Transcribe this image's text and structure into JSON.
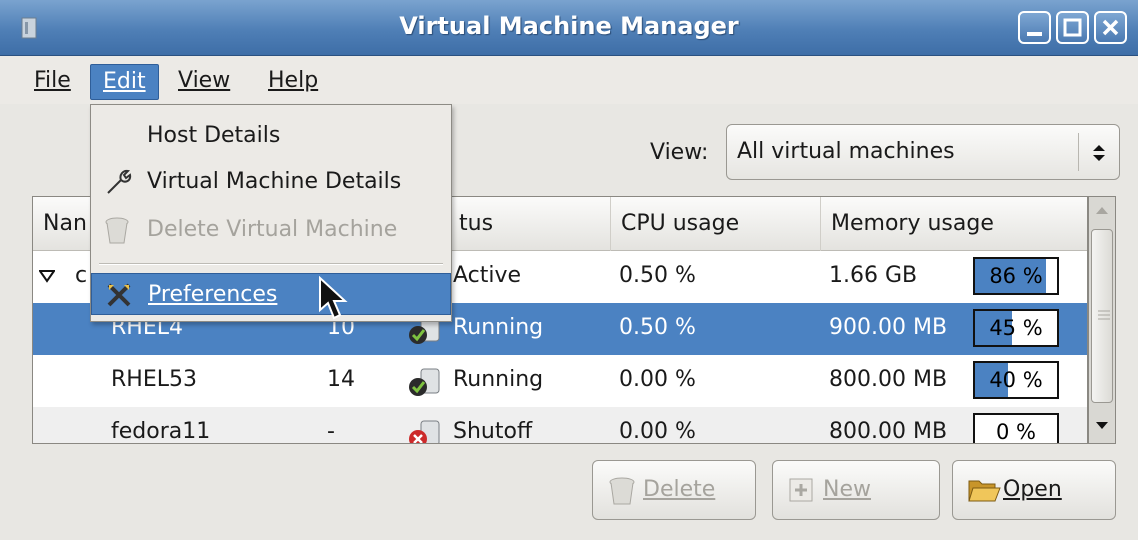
{
  "window": {
    "title": "Virtual Machine Manager"
  },
  "menubar": {
    "items": [
      {
        "label": "File"
      },
      {
        "label": "Edit"
      },
      {
        "label": "View"
      },
      {
        "label": "Help"
      }
    ]
  },
  "view_selector": {
    "label": "View:",
    "value": "All virtual machines"
  },
  "table": {
    "columns": [
      "Nan",
      "tus",
      "CPU usage",
      "Memory usage"
    ],
    "rows": [
      {
        "name": "c",
        "id": "",
        "status": "Active",
        "cpu": "0.50 %",
        "memory": "1.66 GB",
        "mem_pct_label": "86 %",
        "mem_fraction": 0.86
      },
      {
        "name": "RHEL4",
        "id": "10",
        "status": "Running",
        "cpu": "0.50 %",
        "memory": "900.00 MB",
        "mem_pct_label": "45 %",
        "mem_fraction": 0.45
      },
      {
        "name": "RHEL53",
        "id": "14",
        "status": "Running",
        "cpu": "0.00 %",
        "memory": "800.00 MB",
        "mem_pct_label": "40 %",
        "mem_fraction": 0.4
      },
      {
        "name": "fedora11",
        "id": "-",
        "status": "Shutoff",
        "cpu": "0.00 %",
        "memory": "800.00 MB",
        "mem_pct_label": "0 %",
        "mem_fraction": 0.0
      }
    ]
  },
  "buttons": {
    "delete": "Delete",
    "new": "New",
    "open": "Open"
  },
  "edit_menu": {
    "items": [
      {
        "label": "Host Details"
      },
      {
        "label": "Virtual Machine Details"
      },
      {
        "label": "Delete Virtual Machine"
      },
      {
        "label": "Preferences"
      }
    ]
  },
  "colors": {
    "selection": "#4b82c2",
    "titlebar": "#4f7fb6"
  }
}
